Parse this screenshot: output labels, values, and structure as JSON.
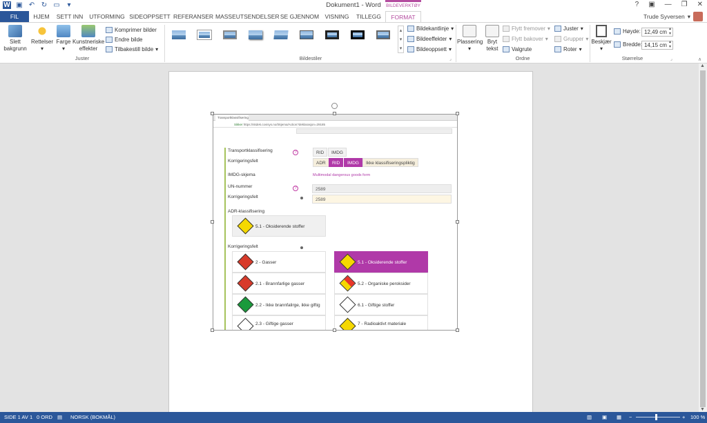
{
  "window": {
    "title": "Dokument1 - Word",
    "context_tab_header": "BILDEVERKTØY",
    "user_name": "Trude Syversen"
  },
  "tabs": [
    "FIL",
    "HJEM",
    "SETT INN",
    "UTFORMING",
    "SIDEOPPSETT",
    "REFERANSER",
    "MASSEUTSENDELSER",
    "SE GJENNOM",
    "VISNING",
    "TILLEGG",
    "FORMAT"
  ],
  "ribbon": {
    "juster": {
      "label": "Juster",
      "slett_bakgrunn": "Slett bakgrunn",
      "rettelser": "Rettelser",
      "farge": "Farge",
      "kunstneriske": "Kunstneriske effekter",
      "komprimer": "Komprimer bilder",
      "endre": "Endre bilde",
      "tilbakestill": "Tilbakestill bilde"
    },
    "bildestiler": {
      "label": "Bildestiler",
      "kantlinje": "Bildekantlinje",
      "effekter": "Bildeeffekter",
      "oppsett": "Bildeoppsett"
    },
    "ordne": {
      "label": "Ordne",
      "plassering": "Plassering",
      "bryt_tekst": "Bryt tekst",
      "flytt_fremover": "Flytt fremover",
      "flytt_bakover": "Flytt bakover",
      "valgrute": "Valgrute",
      "juster": "Juster",
      "grupper": "Grupper",
      "roter": "Roter"
    },
    "storrelse": {
      "label": "Størrelse",
      "beskjaer": "Beskjær",
      "hoyde_label": "Høyde:",
      "hoyde_value": "12,49 cm",
      "bredde_label": "Bredde:",
      "bredde_value": "14,15 cm"
    }
  },
  "embedded_image": {
    "browser_tab": "Transportklassifisering",
    "secure_label": "Sikker",
    "url": "https://skdek.covisys.no/Skjema/Action?deklarasjon=29185",
    "transport_label": "Transportklassifisering",
    "korrigeringsfelt": "Korrigeringsfelt",
    "row1_pills": [
      "RID",
      "IMDG"
    ],
    "row2_pills": [
      "ADR",
      "RID",
      "IMDG",
      "Ikke klassifiseringspliktig"
    ],
    "imdg_label": "IMDG-skjema",
    "imdg_value": "Multimodal dangerous goods form",
    "un_label": "UN-nummer",
    "un_value": "2589",
    "un_corr_value": "2589",
    "adr_label": "ADR-klassifisering",
    "adr_selected": "5.1 - Oksiderende stoffer",
    "korr_label2": "Korrigeringsfelt",
    "hazard_cards": [
      {
        "text": "2 - Gasser",
        "color": "#d83a2a"
      },
      {
        "text": "5.1 - Oksiderende stoffer",
        "color": "#f5d800"
      },
      {
        "text": "2.1 - Brannfarlige gasser",
        "color": "#d83a2a"
      },
      {
        "text": "5.2 - Organiske peroksider",
        "color": "#e8362a"
      },
      {
        "text": "2.2 - Ikke brannfalirge, ikke giftig",
        "color": "#1a9a3c"
      },
      {
        "text": "6.1 - Giftige stoffer",
        "color": "#ffffff"
      },
      {
        "text": "2.3 - Giftige gasser",
        "color": "#ffffff"
      },
      {
        "text": "7 - Radioaktivt materiale",
        "color": "#f5d800"
      }
    ]
  },
  "status": {
    "page": "SIDE 1 AV 1",
    "words": "0 ORD",
    "language": "NORSK (BOKMÅL)",
    "zoom": "100 %"
  }
}
